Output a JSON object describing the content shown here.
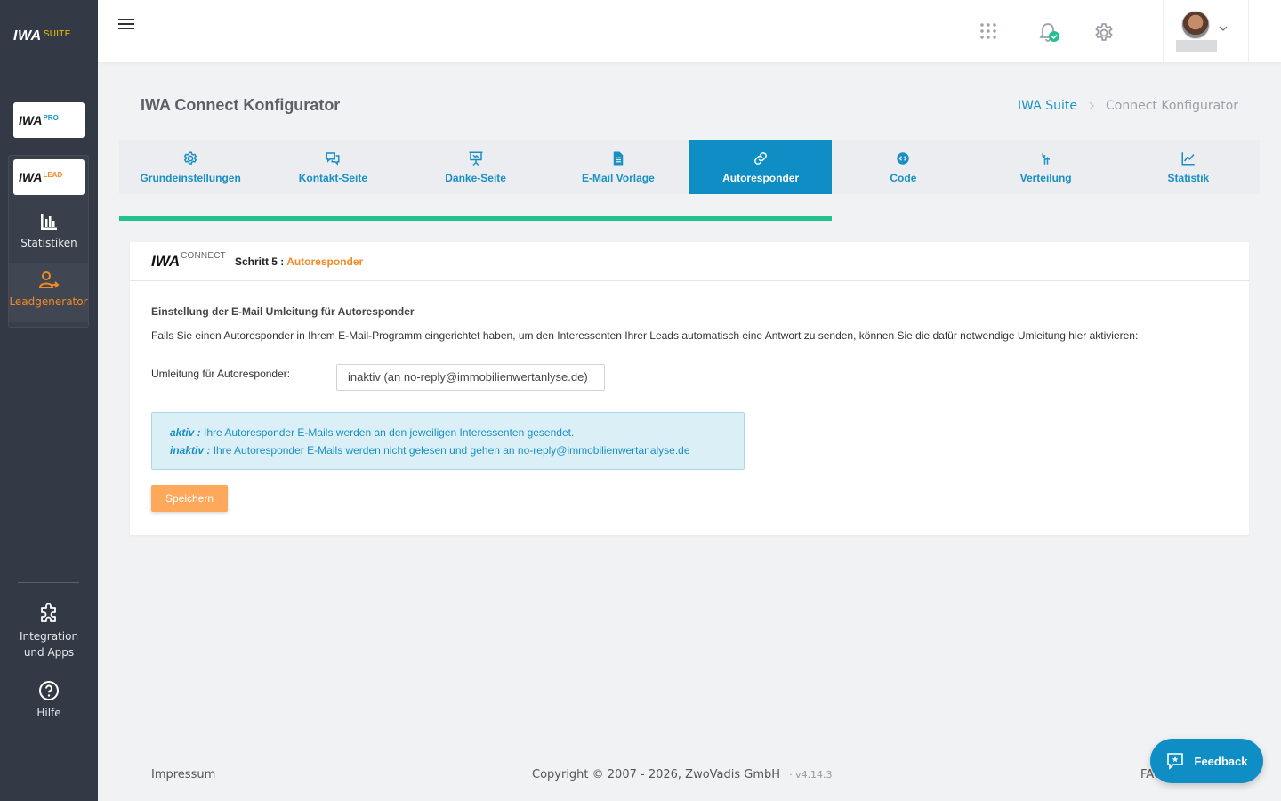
{
  "sidebar": {
    "brand": {
      "main": "IWA",
      "sub": "SUITE"
    },
    "apps": [
      {
        "main": "IWA",
        "sub": "PRO"
      },
      {
        "main": "IWA",
        "sub": "LEAD"
      }
    ],
    "items": {
      "stats": "Statistiken",
      "leadgen": "Leadgenerator",
      "integ_line1": "Integration",
      "integ_line2": "und Apps",
      "help": "Hilfe"
    }
  },
  "header": {
    "title": "IWA Connect Konfigurator",
    "breadcrumb": {
      "home": "IWA Suite",
      "current": "Connect Konfigurator"
    }
  },
  "tabs": [
    {
      "label": "Grundeinstellungen",
      "icon": "gear-icon"
    },
    {
      "label": "Kontakt-Seite",
      "icon": "chat-icon"
    },
    {
      "label": "Danke-Seite",
      "icon": "presentation-icon"
    },
    {
      "label": "E-Mail Vorlage",
      "icon": "document-icon"
    },
    {
      "label": "Autoresponder",
      "icon": "link-icon",
      "active": true
    },
    {
      "label": "Code",
      "icon": "code-icon"
    },
    {
      "label": "Verteilung",
      "icon": "split-icon"
    },
    {
      "label": "Statistik",
      "icon": "chart-icon"
    }
  ],
  "progress": 0.625,
  "colors": {
    "accent": "#0e8ec4",
    "progress": "#21c28f",
    "orange": "#f08a24",
    "button": "#fda85a"
  },
  "card": {
    "logo": {
      "main": "IWA",
      "sub": "CONNECT"
    },
    "step_prefix": "Schritt 5 :",
    "step_name": "Autoresponder",
    "section_title": "Einstellung der E-Mail Umleitung für Autoresponder",
    "section_desc": "Falls Sie einen Autoresponder in Ihrem E-Mail-Programm eingerichtet haben, um den Interessenten Ihrer Leads automatisch eine Antwort zu senden, können Sie die dafür notwendige Umleitung hier aktivieren:",
    "field_label": "Umleitung für Autoresponder:",
    "field_value": "inaktiv (an no-reply@immobilienwertanlyse.de)",
    "info": {
      "aktiv_label": "aktiv :",
      "aktiv_text": "Ihre Autoresponder E-Mails werden an den jeweiligen Interessenten gesendet.",
      "inaktiv_label": "inaktiv :",
      "inaktiv_text": "Ihre Autoresponder E-Mails werden nicht gelesen und gehen an no-reply@immobilienwertanalyse.de"
    },
    "save_label": "Speichern"
  },
  "footer": {
    "impressum": "Impressum",
    "copyright": "Copyright © 2007 - 2026, ZwoVadis GmbH",
    "version": "· v4.14.3",
    "faq": "FAQ"
  },
  "feedback": {
    "label": "Feedback"
  }
}
